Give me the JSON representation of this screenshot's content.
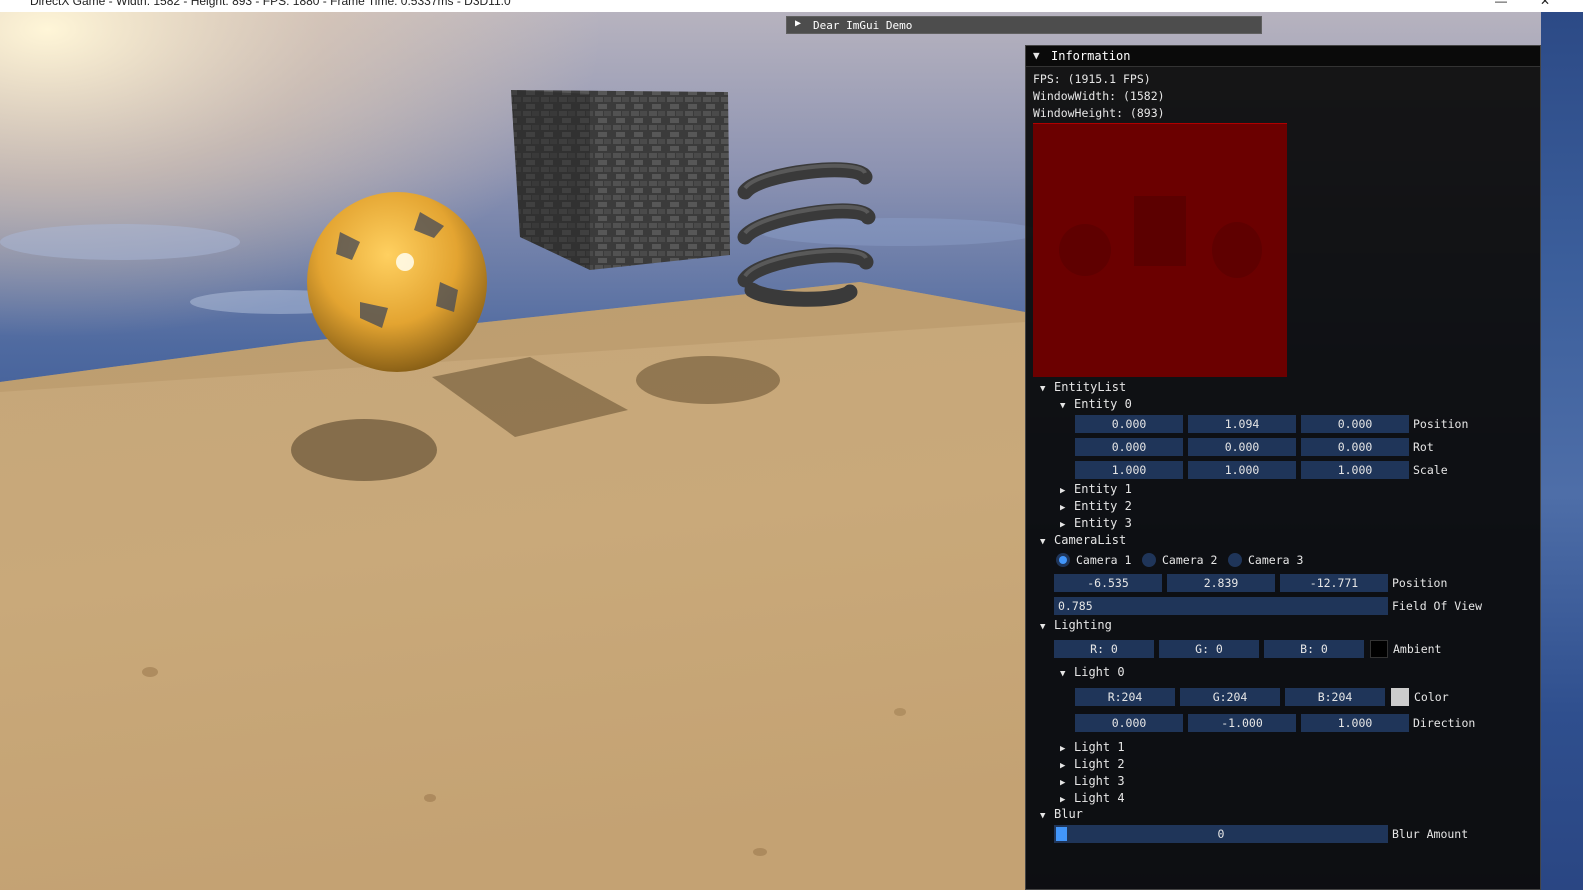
{
  "window": {
    "title": "DirectX Game - Width: 1582 - Height: 893 - FPS: 1880 - Frame Time: 0.5337ms - D3D11.0",
    "minimize": "—",
    "close": "✕"
  },
  "demo_window": {
    "title": "Dear ImGui Demo"
  },
  "info": {
    "title": "Information",
    "fps": "FPS: (1915.1 FPS)",
    "width": "WindowWidth: (1582)",
    "height": "WindowHeight: (893)",
    "entity_list": {
      "label": "EntityList",
      "entity0": {
        "label": "Entity 0",
        "position": [
          "0.000",
          "1.094",
          "0.000"
        ],
        "position_label": "Position",
        "rot": [
          "0.000",
          "0.000",
          "0.000"
        ],
        "rot_label": "Rot",
        "scale": [
          "1.000",
          "1.000",
          "1.000"
        ],
        "scale_label": "Scale"
      },
      "collapsed": [
        "Entity 1",
        "Entity 2",
        "Entity 3"
      ]
    },
    "camera_list": {
      "label": "CameraList",
      "cameras": [
        "Camera 1",
        "Camera 2",
        "Camera 3"
      ],
      "selected": "Camera 1",
      "position": [
        "-6.535",
        "2.839",
        "-12.771"
      ],
      "position_label": "Position",
      "fov": "0.785",
      "fov_label": "Field Of View"
    },
    "lighting": {
      "label": "Lighting",
      "ambient": [
        "R:  0",
        "G:  0",
        "B:  0"
      ],
      "ambient_label": "Ambient",
      "ambient_color": "#000000",
      "light0": {
        "label": "Light 0",
        "color": [
          "R:204",
          "G:204",
          "B:204"
        ],
        "color_label": "Color",
        "color_swatch": "#cccccc",
        "direction": [
          "0.000",
          "-1.000",
          "1.000"
        ],
        "direction_label": "Direction"
      },
      "collapsed": [
        "Light 1",
        "Light 2",
        "Light 3",
        "Light 4"
      ]
    },
    "blur": {
      "label": "Blur",
      "amount": "0",
      "amount_label": "Blur Amount"
    }
  },
  "colors": {
    "frame_bg": "#1f3559",
    "accent": "#4296fa",
    "preview": "#6b0000"
  }
}
